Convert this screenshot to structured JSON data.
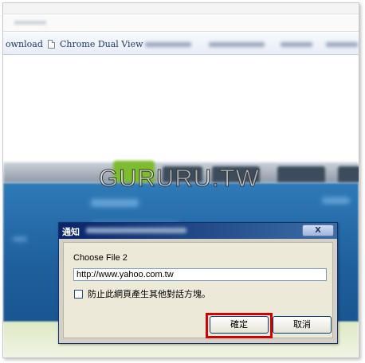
{
  "browser": {
    "bookmarks": [
      {
        "label": "ownload"
      },
      {
        "label": "Chrome Dual View"
      }
    ]
  },
  "watermark": "GURURU.TW",
  "dialog": {
    "title": "通知",
    "close_label": "X",
    "message": "Choose File 2",
    "input_value": "http://www.yahoo.com.tw",
    "checkbox_label": "防止此網頁產生其他對話方塊。",
    "ok_label": "確定",
    "cancel_label": "取消",
    "highlight_color": "#d20000"
  }
}
